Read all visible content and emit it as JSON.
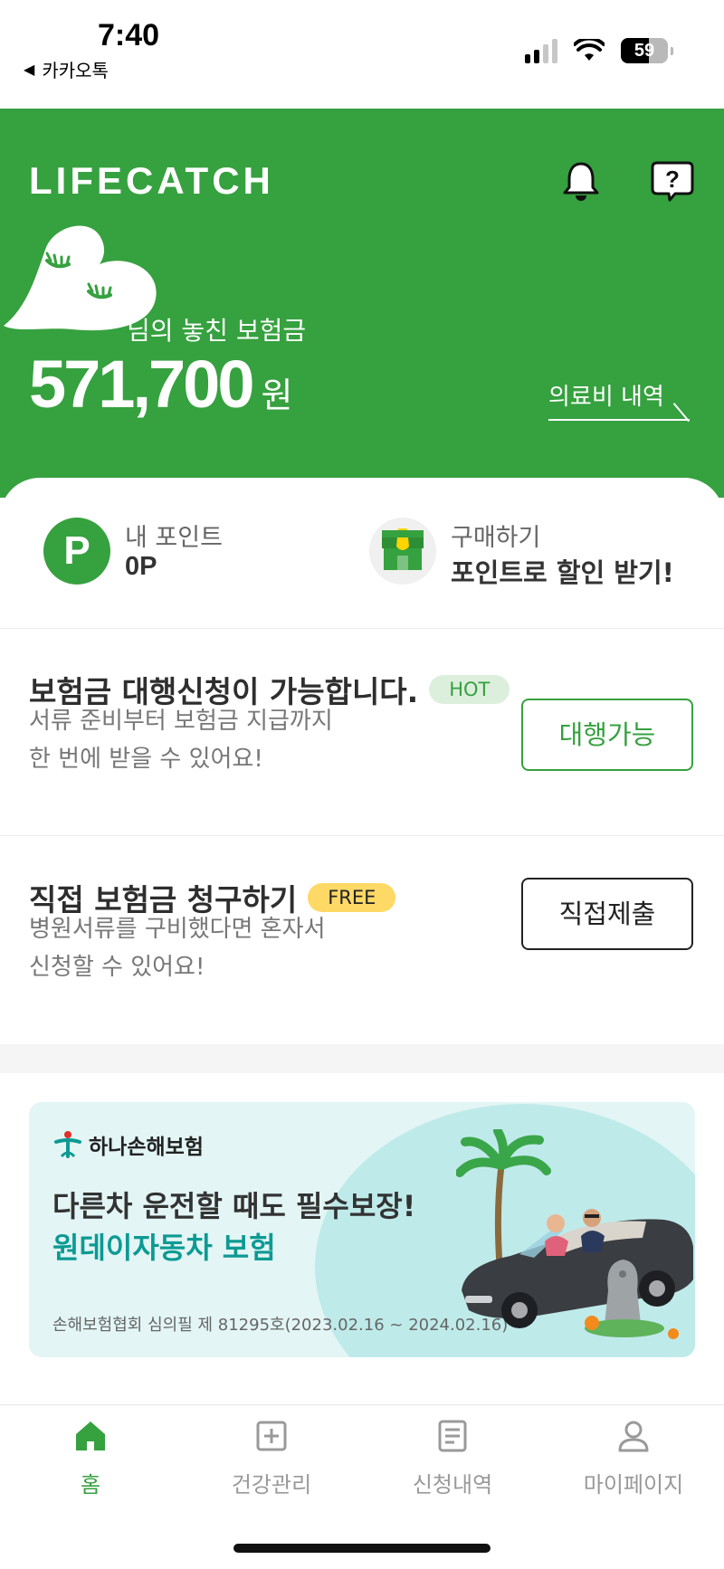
{
  "status_bar": {
    "time": "7:40",
    "back_app": "카카오톡",
    "battery": "59"
  },
  "header": {
    "logo": "LIFECATCH",
    "missed_label": "님의 놓친 보험금",
    "amount": "571,700",
    "unit": "원",
    "medical_link": "의료비 내역"
  },
  "points": {
    "my_points_label": "내 포인트",
    "my_points_value": "0P",
    "icon_letter": "P",
    "shop_label": "구매하기",
    "shop_value": "포인트로 할인 받기!"
  },
  "agency": {
    "title": "보험금 대행신청이 가능합니다.",
    "badge": "HOT",
    "desc_line1": "서류 준비부터 보험금 지급까지",
    "desc_line2": "한 번에 받을 수 있어요!",
    "button": "대행가능"
  },
  "direct": {
    "title": "직접 보험금 청구하기",
    "badge": "FREE",
    "desc_line1": "병원서류를 구비했다면 혼자서",
    "desc_line2": "신청할 수 있어요!",
    "button": "직접제출"
  },
  "banner": {
    "brand": "하나손해보험",
    "line1": "다른차 운전할 때도 필수보장!",
    "line2": "원데이자동차 보험",
    "note": "손해보험협회 심의필 제 81295호(2023.02.16 ~ 2024.02.16)"
  },
  "nav": {
    "items": [
      {
        "label": "홈",
        "icon": "home-icon"
      },
      {
        "label": "건강관리",
        "icon": "health-plus-icon"
      },
      {
        "label": "신청내역",
        "icon": "document-list-icon"
      },
      {
        "label": "마이페이지",
        "icon": "person-icon"
      }
    ]
  },
  "colors": {
    "brand_green": "#36a13f",
    "hot_badge_bg": "#dcefdc",
    "free_badge_bg": "#ffd966",
    "banner_accent": "#0d9a93"
  }
}
